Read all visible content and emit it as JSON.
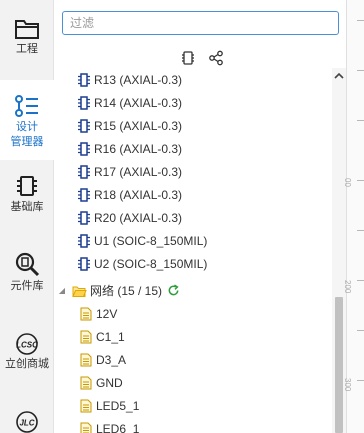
{
  "rail": {
    "items": [
      {
        "label": "工程",
        "icon": "folder-icon"
      },
      {
        "label": "设计\n管理器",
        "icon": "design-manager-icon"
      },
      {
        "label": "基础库",
        "icon": "chip-icon"
      },
      {
        "label": "元件库",
        "icon": "component-search-icon"
      },
      {
        "label": "立创商城",
        "icon": "lcsc-icon"
      },
      {
        "label": "",
        "icon": "jlc-icon"
      }
    ]
  },
  "search": {
    "placeholder": "过滤",
    "value": ""
  },
  "toolbar": {
    "icons": [
      "component-icon",
      "net-share-icon"
    ]
  },
  "components": [
    "R13 (AXIAL-0.3)",
    "R14 (AXIAL-0.3)",
    "R15 (AXIAL-0.3)",
    "R16 (AXIAL-0.3)",
    "R17 (AXIAL-0.3)",
    "R18 (AXIAL-0.3)",
    "R20 (AXIAL-0.3)",
    "U1 (SOIC-8_150MIL)",
    "U2 (SOIC-8_150MIL)"
  ],
  "nets_group": {
    "label": "网络 (15 / 15)",
    "expanded": true
  },
  "nets": [
    "12V",
    "C1_1",
    "D3_A",
    "GND",
    "LED5_1",
    "LED6_1"
  ],
  "ruler": {
    "labels": [
      "00",
      "200",
      "300"
    ]
  },
  "colors": {
    "accent": "#1a73c8",
    "component_icon": "#1d3f8f",
    "folder": "#f0b400",
    "refresh": "#2e9e3a"
  }
}
